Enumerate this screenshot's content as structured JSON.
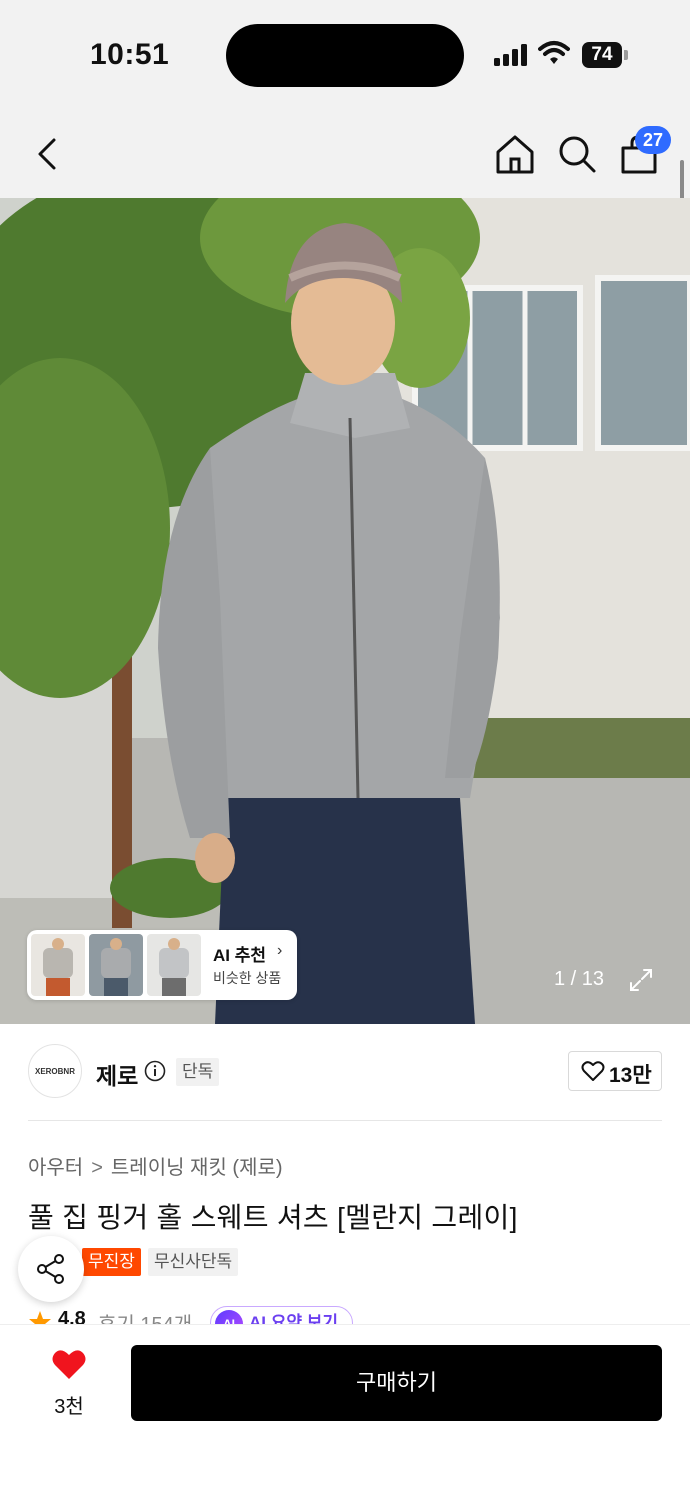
{
  "status_bar": {
    "time": "10:51",
    "battery": "74",
    "icons": [
      "signal-icon",
      "wifi-icon",
      "battery-icon"
    ]
  },
  "nav": {
    "icons": [
      "back-icon",
      "home-icon",
      "search-icon",
      "cart-icon"
    ],
    "cart_badge": "27"
  },
  "gallery": {
    "counter": "1 / 13",
    "ai_recommend": {
      "title": "AI 추천",
      "subtitle": "비슷한 상품"
    }
  },
  "brand": {
    "logo_text": "XEROBNR",
    "name": "제로",
    "exclusive_tag": "단독",
    "like_count": "13만"
  },
  "product": {
    "breadcrumb": [
      "아우터",
      "트레이닝 재킷 (제로)"
    ],
    "breadcrumb_separator": ">",
    "title": "풀 집 핑거 홀 스웨트 셔츠 [멜란지 그레이]",
    "tags": [
      "무진장",
      "무신사단독"
    ],
    "rating": "4.8",
    "reviews": "후기 154개",
    "ai_summary_icon": "AI",
    "ai_summary_label": "AI 요약 보기"
  },
  "bottom_bar": {
    "wish_count": "3천",
    "buy_label": "구매하기"
  },
  "colors": {
    "accent_blue": "#2f6bff",
    "musinsa_orange": "#ff4800",
    "heart_red": "#f0141e",
    "ai_purple": "#6b3ff0"
  }
}
